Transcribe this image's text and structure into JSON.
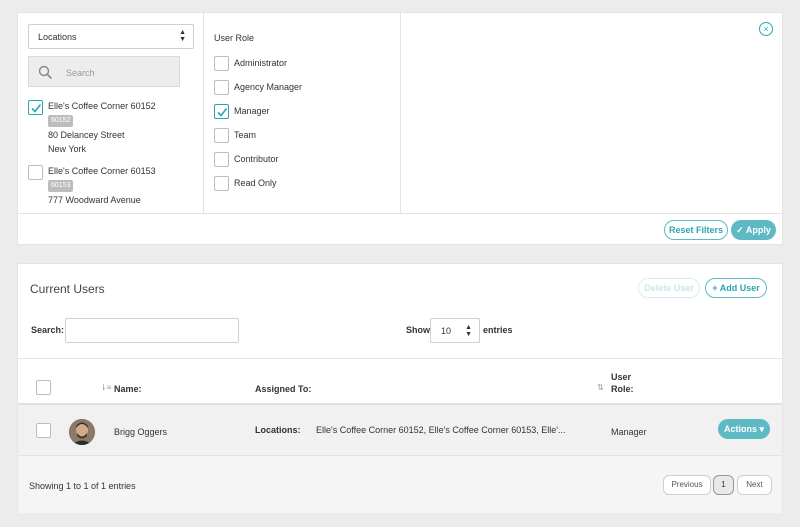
{
  "filters": {
    "locations_select": "Locations",
    "search_placeholder": "Search",
    "locations": [
      {
        "name": "Elle's Coffee Corner 60152",
        "code": "60152",
        "street": "80 Delancey Street",
        "city": "New York",
        "checked": true
      },
      {
        "name": "Elle's Coffee Corner 60153",
        "code": "60153",
        "street": "777 Woodward Avenue",
        "checked": false
      }
    ],
    "role_title": "User Role",
    "roles": [
      {
        "label": "Administrator",
        "checked": false
      },
      {
        "label": "Agency Manager",
        "checked": false
      },
      {
        "label": "Manager",
        "checked": true
      },
      {
        "label": "Team",
        "checked": false
      },
      {
        "label": "Contributor",
        "checked": false
      },
      {
        "label": "Read Only",
        "checked": false
      }
    ],
    "close_icon": "×",
    "reset_label": "Reset Filters",
    "apply_label": "✓ Apply"
  },
  "users": {
    "title": "Current Users",
    "delete_label": "Delete User",
    "add_label": "+ Add User",
    "search_label": "Search:",
    "show_label": "Show",
    "entries_value": "10",
    "entries_label": "entries",
    "columns": {
      "name": "Name:",
      "assigned": "Assigned To:",
      "role_line1": "User",
      "role_line2": "Role:"
    },
    "rows": [
      {
        "name": "Brigg Oggers",
        "assigned_label": "Locations:",
        "assigned_value": "Elle's Coffee Corner 60152, Elle's Coffee Corner 60153, Elle'...",
        "role": "Manager",
        "actions_label": "Actions ▾"
      }
    ],
    "showing_text": "Showing 1 to 1 of 1 entries",
    "pagination": {
      "previous": "Previous",
      "page": "1",
      "next": "Next"
    }
  },
  "colors": {
    "accent": "#5dbac5",
    "checkbox_border": "#2aa6b3"
  }
}
